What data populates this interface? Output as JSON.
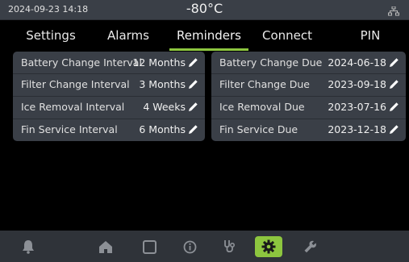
{
  "status_bar": {
    "datetime": "2024-09-23   14:18",
    "temperature": "-80°C",
    "network_icon": "network-icon"
  },
  "tabs": [
    {
      "label": "Settings",
      "active": false
    },
    {
      "label": "Alarms",
      "active": false
    },
    {
      "label": "Reminders",
      "active": true
    },
    {
      "label": "Connect",
      "active": false
    },
    {
      "label": "PIN",
      "active": false
    }
  ],
  "intervals": [
    {
      "label": "Battery Change Interval",
      "value": "12 Months"
    },
    {
      "label": "Filter Change Interval",
      "value": "3 Months"
    },
    {
      "label": "Ice Removal Interval",
      "value": "4 Weeks"
    },
    {
      "label": "Fin Service Interval",
      "value": "6 Months"
    }
  ],
  "due_dates": [
    {
      "label": "Battery Change Due",
      "value": "2024-06-18"
    },
    {
      "label": "Filter Change Due",
      "value": "2023-09-18"
    },
    {
      "label": "Ice Removal Due",
      "value": "2023-07-16"
    },
    {
      "label": "Fin Service Due",
      "value": "2023-12-18"
    }
  ],
  "bottom_nav": [
    {
      "icon": "bell-icon"
    },
    {
      "icon": "home-icon"
    },
    {
      "icon": "square-icon"
    },
    {
      "icon": "info-icon"
    },
    {
      "icon": "stethoscope-icon"
    },
    {
      "icon": "gear-icon",
      "active": true
    },
    {
      "icon": "wrench-icon"
    }
  ],
  "colors": {
    "accent": "#8dc63f",
    "panel": "#3a3f47",
    "background": "#000000"
  }
}
